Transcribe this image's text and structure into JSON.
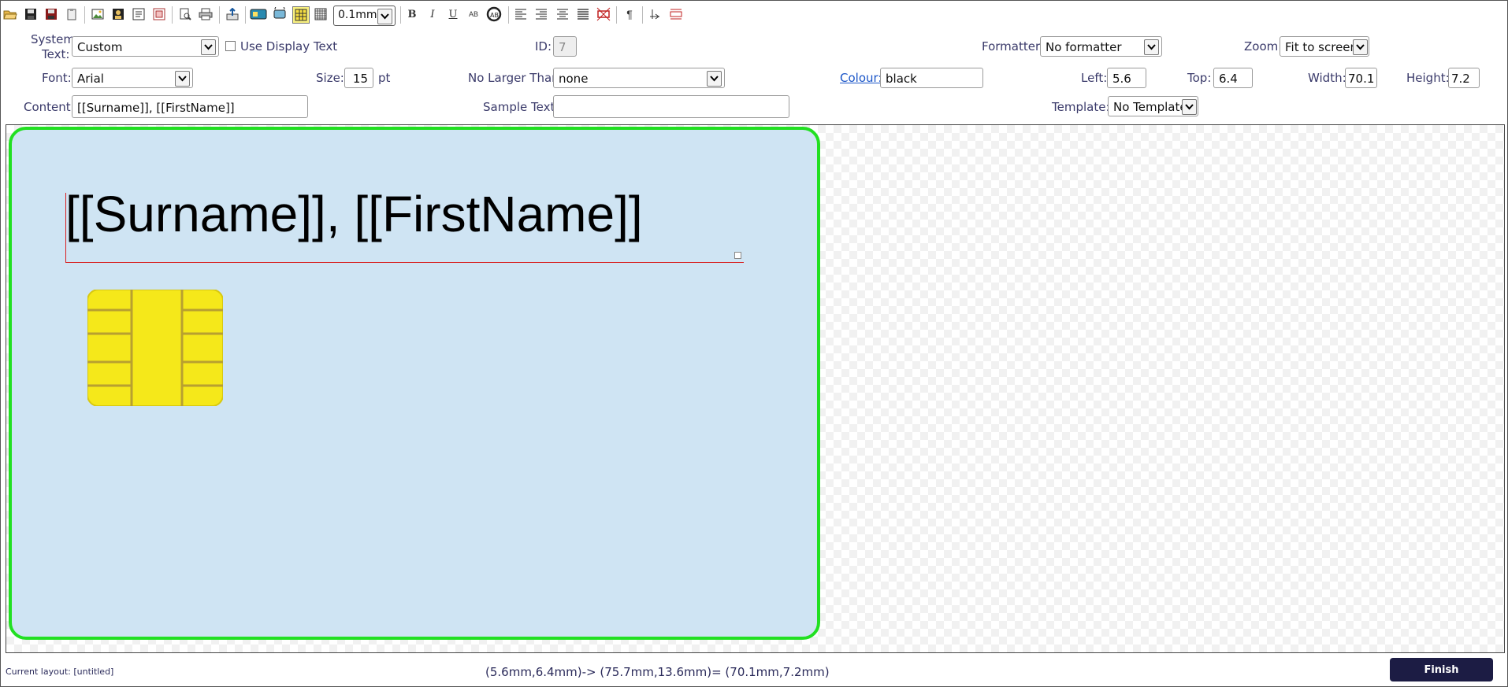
{
  "toolbar": {
    "grid_size": "0.1mm",
    "bold": "B",
    "italic": "I",
    "underline": "U",
    "small_caps": "AB",
    "paragraph": "¶"
  },
  "props": {
    "system_text_label_1": "System",
    "system_text_label_2": "Text:",
    "system_text_value": "Custom",
    "use_display_text_label": "Use Display Text",
    "id_label": "ID:",
    "id_value": "7",
    "formatter_label": "Formatter:",
    "formatter_value": "No formatter",
    "zoom_label": "Zoom:",
    "zoom_value": "Fit to screen",
    "font_label": "Font:",
    "font_value": "Arial",
    "size_label": "Size:",
    "size_value": "15",
    "size_unit": "pt",
    "no_larger_than_label": "No Larger Than:",
    "no_larger_than_value": "none",
    "colour_label": "Colour:",
    "colour_value": "black",
    "left_label": "Left:",
    "left_value": "5.6",
    "top_label": "Top:",
    "top_value": "6.4",
    "width_label": "Width:",
    "width_value": "70.1",
    "height_label": "Height:",
    "height_value": "7.2",
    "content_label": "Content:",
    "content_value": "[[Surname]], [[FirstName]]",
    "sample_text_label": "Sample Text:",
    "sample_text_value": "",
    "template_label": "Template:",
    "template_value": "No Template"
  },
  "canvas": {
    "card_text": "[[Surname]], [[FirstName]]",
    "card_color": "#cfe4f3",
    "border_color": "#22e022",
    "chip_color": "#f5e81a"
  },
  "status": {
    "current_layout": "Current layout: [untitled]",
    "coordinates": "(5.6mm,6.4mm)-> (75.7mm,13.6mm)= (70.1mm,7.2mm)",
    "finish_label": "Finish"
  }
}
